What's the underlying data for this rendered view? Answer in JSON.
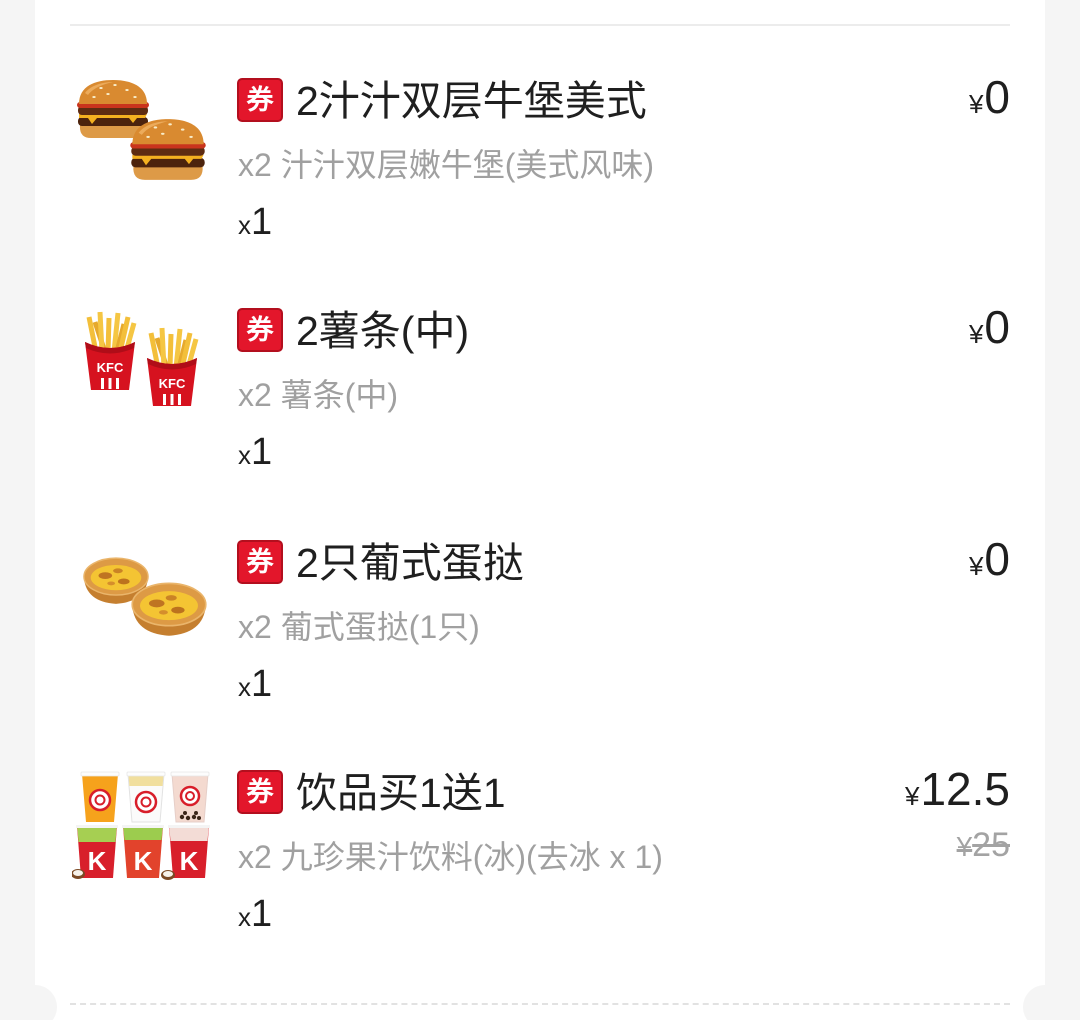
{
  "list": {
    "items": [
      {
        "badge": "券",
        "title": "2汁汁双层牛堡美式",
        "price": {
          "symbol": "¥",
          "amount": "0"
        },
        "detail": "x2 汁汁双层嫩牛堡(美式风味)",
        "quantity": {
          "prefix": "x",
          "value": "1"
        },
        "image_icon": "double-burger-image"
      },
      {
        "badge": "券",
        "title": "2薯条(中)",
        "price": {
          "symbol": "¥",
          "amount": "0"
        },
        "detail": "x2 薯条(中)",
        "quantity": {
          "prefix": "x",
          "value": "1"
        },
        "image_icon": "fries-image",
        "image_logo": "KFC"
      },
      {
        "badge": "券",
        "title": "2只葡式蛋挞",
        "price": {
          "symbol": "¥",
          "amount": "0"
        },
        "detail": "x2 葡式蛋挞(1只)",
        "quantity": {
          "prefix": "x",
          "value": "1"
        },
        "image_icon": "egg-tart-image"
      },
      {
        "badge": "券",
        "title": "饮品买1送1",
        "price": {
          "symbol": "¥",
          "amount": "12.5"
        },
        "original_price": {
          "symbol": "¥",
          "amount": "25"
        },
        "detail": "x2 九珍果汁饮料(冰)(去冰 x 1)",
        "quantity": {
          "prefix": "x",
          "value": "1"
        },
        "image_icon": "drinks-image",
        "image_logo": "K"
      }
    ]
  },
  "colors": {
    "page_background": "#f5f5f5",
    "card_background": "#ffffff",
    "coupon_badge_red": "#e3162b",
    "primary_text": "#1f1f1f",
    "secondary_text": "#a0a0a0",
    "divider": "#ececec"
  }
}
